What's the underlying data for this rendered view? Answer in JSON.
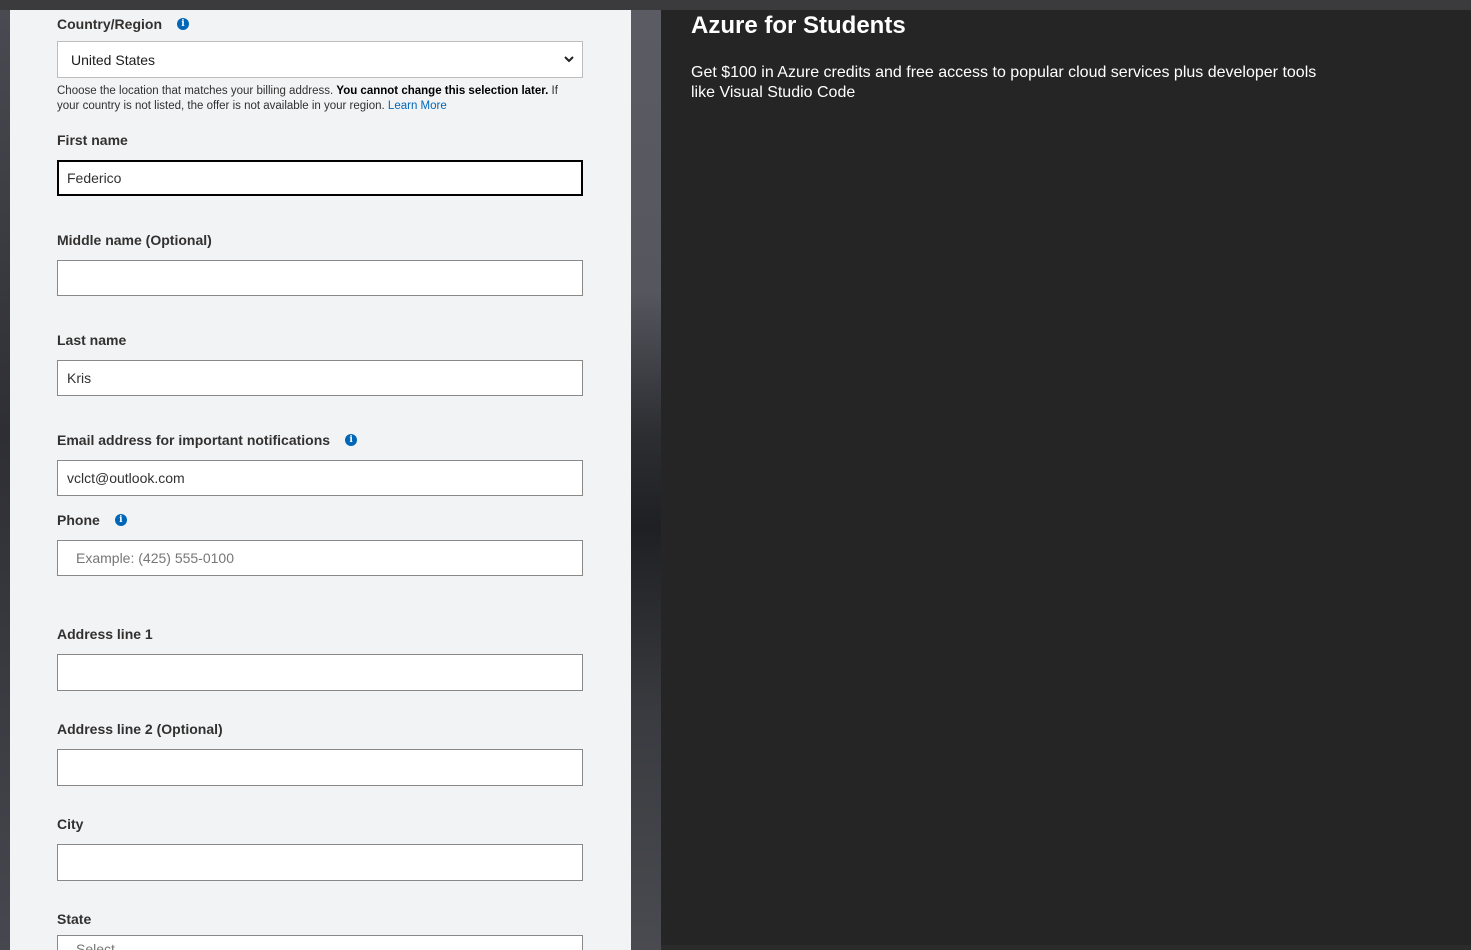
{
  "form": {
    "country": {
      "label": "Country/Region",
      "value": "United States",
      "help_text": "Choose the location that matches your billing address.",
      "help_bold": "You cannot change this selection later.",
      "help_text2": "If your country is not listed, the offer is not available in your region.",
      "help_link": "Learn More"
    },
    "first_name": {
      "label": "First name",
      "value": "Federico"
    },
    "middle_name": {
      "label": "Middle name (Optional)",
      "value": ""
    },
    "last_name": {
      "label": "Last name",
      "value": "Kris"
    },
    "email": {
      "label": "Email address for important notifications",
      "value": "vclct@outlook.com"
    },
    "phone": {
      "label": "Phone",
      "placeholder": "Example: (425) 555-0100"
    },
    "address1": {
      "label": "Address line 1",
      "value": ""
    },
    "address2": {
      "label": "Address line 2 (Optional)",
      "value": ""
    },
    "city": {
      "label": "City",
      "value": ""
    },
    "state": {
      "label": "State",
      "value": "Select"
    }
  },
  "promo": {
    "title": "Azure for Students",
    "description": "Get $100 in Azure credits and free access to popular cloud services plus developer tools like Visual Studio Code"
  },
  "icons": {
    "info": "info-icon",
    "dropdown": "chevron-down-icon"
  },
  "colors": {
    "link": "#0067b8",
    "panel": "#f2f3f5",
    "dark": "#252526"
  }
}
